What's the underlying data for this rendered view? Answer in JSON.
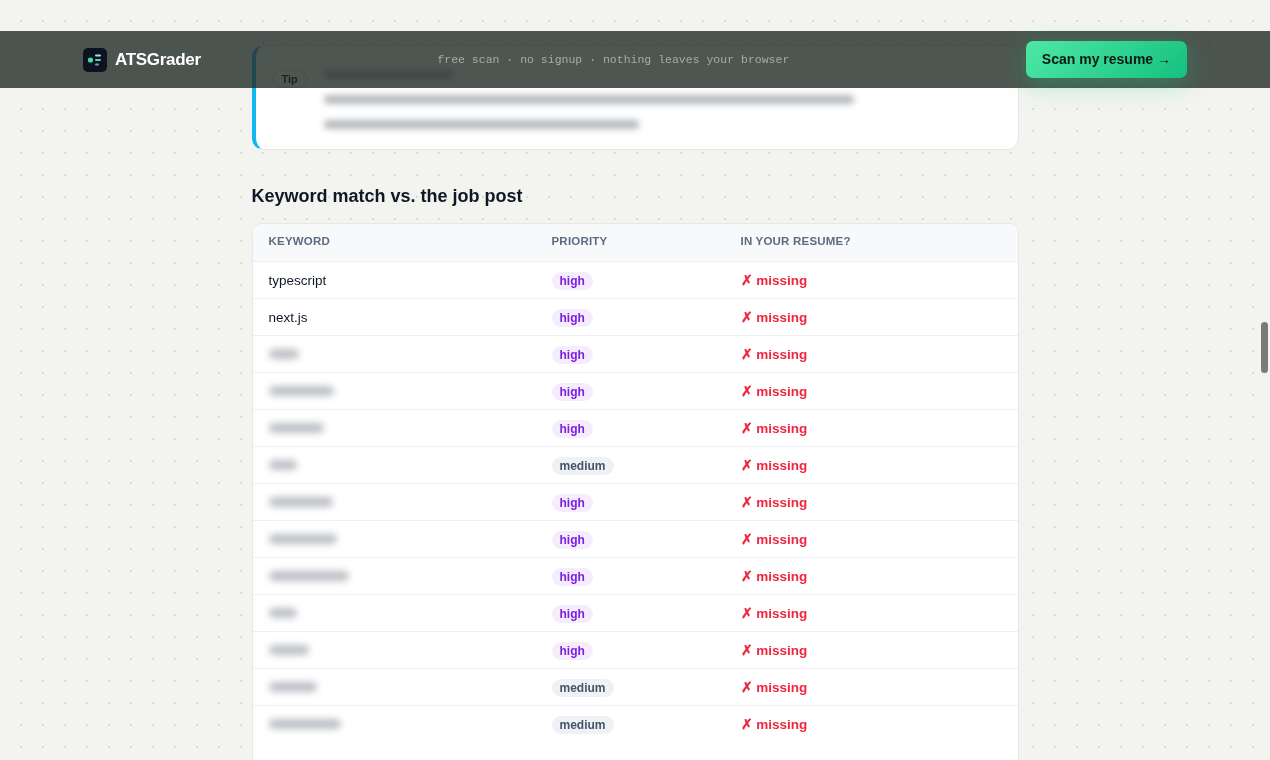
{
  "header": {
    "brand": "ATSGrader",
    "tagline": "free scan · no signup · nothing leaves your browser",
    "cta": "Scan my resume →"
  },
  "tip": {
    "badge": "Tip",
    "blurred": true
  },
  "keyword_section": {
    "title": "Keyword match vs. the job post",
    "table": {
      "columns": [
        "KEYWORD",
        "PRIORITY",
        "IN YOUR RESUME?"
      ],
      "rows": [
        {
          "keyword": "typescript",
          "blurred": false,
          "priority": "high",
          "color": "#7c1fe0",
          "status": "✗ missing"
        },
        {
          "keyword": "next.js",
          "blurred": false,
          "priority": "high",
          "color": "#7c1fe0",
          "status": "✗ missing"
        },
        {
          "blurred": true,
          "priority": "high",
          "color": "#7c1fe0",
          "status": "✗ missing"
        },
        {
          "blurred": true,
          "priority": "high",
          "color": "#7c1fe0",
          "status": "✗ missing"
        },
        {
          "blurred": true,
          "priority": "high",
          "color": "#7c1fe0",
          "status": "✗ missing"
        },
        {
          "blurred": true,
          "priority": "medium",
          "color": "#475467",
          "status": "✗ missing"
        },
        {
          "blurred": true,
          "priority": "high",
          "color": "#7c1fe0",
          "status": "✗ missing"
        },
        {
          "blurred": true,
          "priority": "high",
          "color": "#7c1fe0",
          "status": "✗ missing"
        },
        {
          "blurred": true,
          "priority": "high",
          "color": "#7c1fe0",
          "status": "✗ missing"
        },
        {
          "blurred": true,
          "priority": "high",
          "color": "#7c1fe0",
          "status": "✗ missing"
        },
        {
          "blurred": true,
          "priority": "high",
          "color": "#7c1fe0",
          "status": "✗ missing"
        },
        {
          "blurred": true,
          "priority": "medium",
          "color": "#475467",
          "status": "✗ missing"
        },
        {
          "blurred": true,
          "priority": "medium",
          "color": "#475467",
          "status": "✗ missing"
        }
      ]
    }
  }
}
